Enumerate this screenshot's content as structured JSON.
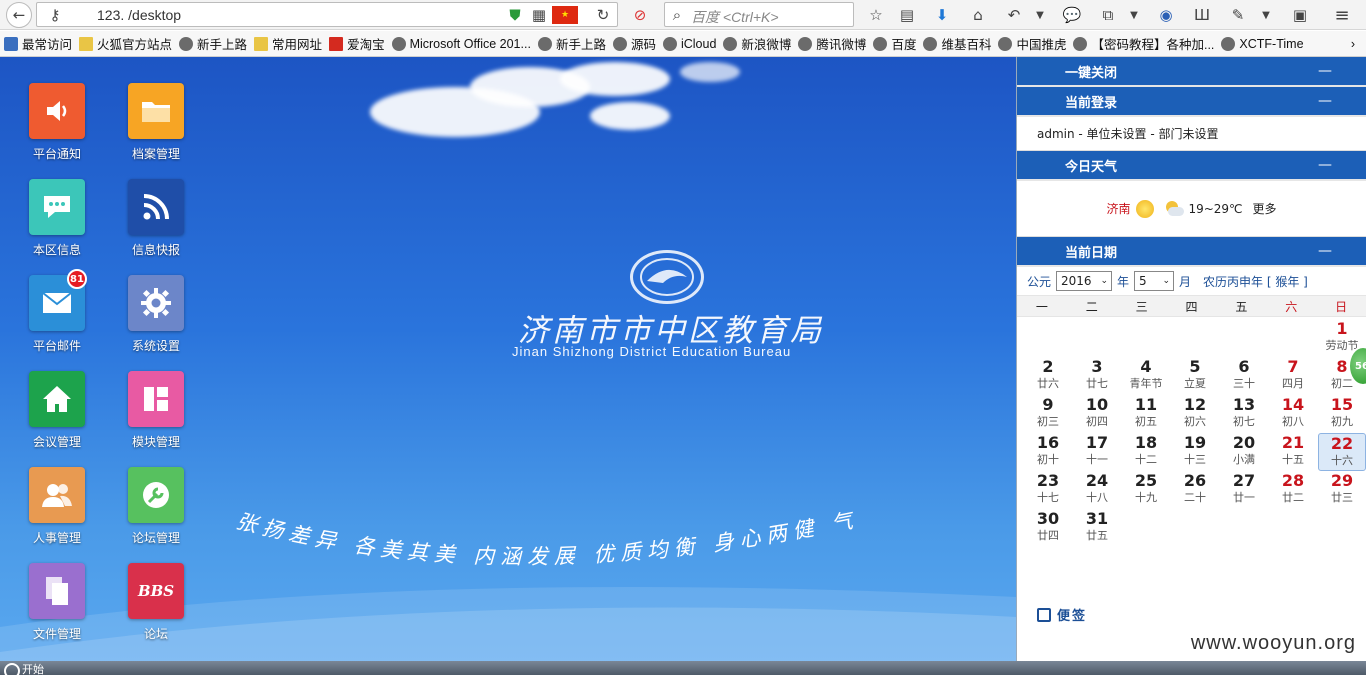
{
  "browser": {
    "url": "123.          /desktop",
    "search_placeholder": "百度 <Ctrl+K>",
    "bookmarks": [
      "最常访问",
      "火狐官方站点",
      "新手上路",
      "常用网址",
      "爱淘宝",
      "Microsoft Office 201...",
      "新手上路",
      "源码",
      "iCloud",
      "新浪微博",
      "腾讯微博",
      "百度",
      "维基百科",
      "中国推虎",
      "【密码教程】各种加...",
      "XCTF-Time"
    ],
    "bookmark_more": "›"
  },
  "desktop": {
    "apps_left": [
      {
        "label": "平台通知",
        "icon": "speaker-icon",
        "color": "#ef5b30"
      },
      {
        "label": "本区信息",
        "icon": "chat-icon",
        "color": "#3cc6b9"
      },
      {
        "label": "平台邮件",
        "icon": "mail-icon",
        "color": "#2b8fd8",
        "badge": "81"
      },
      {
        "label": "会议管理",
        "icon": "home-icon",
        "color": "#1da34c"
      },
      {
        "label": "人事管理",
        "icon": "people-icon",
        "color": "#e89a51"
      },
      {
        "label": "文件管理",
        "icon": "files-icon",
        "color": "#9a6fcf"
      }
    ],
    "apps_right": [
      {
        "label": "档案管理",
        "icon": "folder-icon",
        "color": "#f7a524"
      },
      {
        "label": "信息快报",
        "icon": "rss-icon",
        "color": "#1f4ea8"
      },
      {
        "label": "系统设置",
        "icon": "gear-icon",
        "color": "#6c86c9"
      },
      {
        "label": "模块管理",
        "icon": "module-icon",
        "color": "#e85aa3"
      },
      {
        "label": "论坛管理",
        "icon": "wrench-icon",
        "color": "#57c15f"
      },
      {
        "label": "论坛",
        "icon": "bbs-icon",
        "color": "#d9304b",
        "text": "BBS"
      }
    ],
    "org_title": "济南市市中区教育局",
    "org_subtitle": "Jinan Shizhong District Education Bureau",
    "slogan": "张扬差异 各美其美   内涵发展 优质均衡   身心两健 气"
  },
  "panel": {
    "close_all": "一键关闭",
    "current_login": "当前登录",
    "login_info": "admin - 单位未设置 - 部门未设置",
    "weather_title": "今日天气",
    "weather_city": "济南",
    "weather_temp": "19~29℃",
    "weather_more": "更多",
    "date_title": "当前日期",
    "minimize": "—",
    "era_label": "公元",
    "year": "2016",
    "year_unit": "年",
    "month": "5",
    "month_unit": "月",
    "lunar": "农历丙申年 [ 猴年 ]",
    "weekdays": [
      "一",
      "二",
      "三",
      "四",
      "五",
      "六",
      "日"
    ],
    "days": [
      {
        "n": "1",
        "l": "劳动节",
        "col": 6,
        "row": 0,
        "red": true
      },
      {
        "n": "2",
        "l": "廿六",
        "col": 0,
        "row": 1
      },
      {
        "n": "3",
        "l": "廿七",
        "col": 1,
        "row": 1
      },
      {
        "n": "4",
        "l": "青年节",
        "col": 2,
        "row": 1
      },
      {
        "n": "5",
        "l": "立夏",
        "col": 3,
        "row": 1
      },
      {
        "n": "6",
        "l": "三十",
        "col": 4,
        "row": 1
      },
      {
        "n": "7",
        "l": "四月",
        "col": 5,
        "row": 1,
        "red": true
      },
      {
        "n": "8",
        "l": "初二",
        "col": 6,
        "row": 1,
        "red": true
      },
      {
        "n": "9",
        "l": "初三",
        "col": 0,
        "row": 2
      },
      {
        "n": "10",
        "l": "初四",
        "col": 1,
        "row": 2
      },
      {
        "n": "11",
        "l": "初五",
        "col": 2,
        "row": 2
      },
      {
        "n": "12",
        "l": "初六",
        "col": 3,
        "row": 2
      },
      {
        "n": "13",
        "l": "初七",
        "col": 4,
        "row": 2
      },
      {
        "n": "14",
        "l": "初八",
        "col": 5,
        "row": 2,
        "red": true
      },
      {
        "n": "15",
        "l": "初九",
        "col": 6,
        "row": 2,
        "red": true
      },
      {
        "n": "16",
        "l": "初十",
        "col": 0,
        "row": 3
      },
      {
        "n": "17",
        "l": "十一",
        "col": 1,
        "row": 3
      },
      {
        "n": "18",
        "l": "十二",
        "col": 2,
        "row": 3
      },
      {
        "n": "19",
        "l": "十三",
        "col": 3,
        "row": 3
      },
      {
        "n": "20",
        "l": "小满",
        "col": 4,
        "row": 3
      },
      {
        "n": "21",
        "l": "十五",
        "col": 5,
        "row": 3,
        "red": true
      },
      {
        "n": "22",
        "l": "十六",
        "col": 6,
        "row": 3,
        "red": true,
        "today": true
      },
      {
        "n": "23",
        "l": "十七",
        "col": 0,
        "row": 4
      },
      {
        "n": "24",
        "l": "十八",
        "col": 1,
        "row": 4
      },
      {
        "n": "25",
        "l": "十九",
        "col": 2,
        "row": 4
      },
      {
        "n": "26",
        "l": "二十",
        "col": 3,
        "row": 4
      },
      {
        "n": "27",
        "l": "廿一",
        "col": 4,
        "row": 4
      },
      {
        "n": "28",
        "l": "廿二",
        "col": 5,
        "row": 4,
        "red": true
      },
      {
        "n": "29",
        "l": "廿三",
        "col": 6,
        "row": 4,
        "red": true
      },
      {
        "n": "30",
        "l": "廿四",
        "col": 0,
        "row": 5
      },
      {
        "n": "31",
        "l": "廿五",
        "col": 1,
        "row": 5
      }
    ],
    "note_label": "便签",
    "float_badge": "56"
  },
  "watermark": "www.wooyun.org",
  "taskbar": {
    "start_label": "开始"
  }
}
